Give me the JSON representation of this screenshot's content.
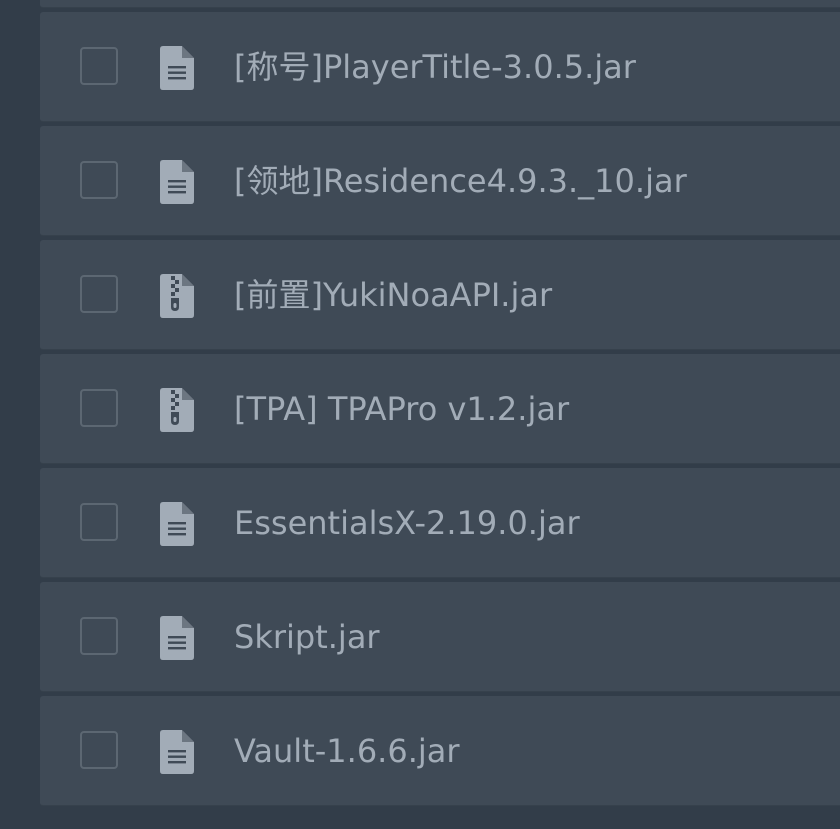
{
  "colors": {
    "background": "#323d49",
    "row_background": "#3f4a56",
    "text": "#a2acb7",
    "icon": "#a2acb7"
  },
  "files": [
    {
      "name": "[称号]PlayerTitle-3.0.5.jar",
      "icon": "file-text-icon"
    },
    {
      "name": "[领地]Residence4.9.3._10.jar",
      "icon": "file-text-icon"
    },
    {
      "name": "[前置]YukiNoaAPI.jar",
      "icon": "file-archive-icon"
    },
    {
      "name": "[TPA] TPAPro v1.2.jar",
      "icon": "file-archive-icon"
    },
    {
      "name": "EssentialsX-2.19.0.jar",
      "icon": "file-text-icon"
    },
    {
      "name": "Skript.jar",
      "icon": "file-text-icon"
    },
    {
      "name": "Vault-1.6.6.jar",
      "icon": "file-text-icon"
    }
  ]
}
